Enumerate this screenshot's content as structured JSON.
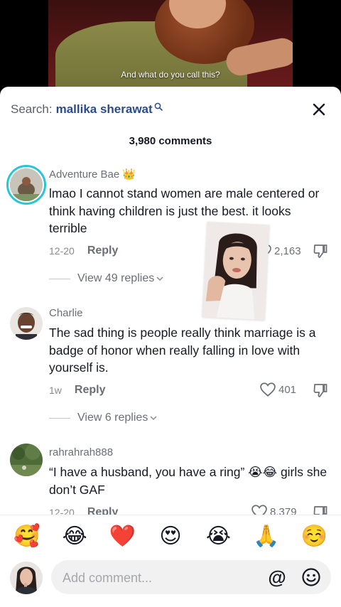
{
  "video": {
    "subtitle": "And what do you call this?"
  },
  "sheet": {
    "search_prefix": "Search:",
    "search_term": "mallika sherawat",
    "comment_count": "3,980 comments"
  },
  "comments": [
    {
      "user": "Adventure Bae 👑",
      "text": "lmao I cannot stand women are male centered or think having children is just the best. it looks terrible",
      "date": "12-20",
      "reply": "Reply",
      "likes": "2,163",
      "view_replies": "View 49 replies"
    },
    {
      "user": "Charlie",
      "text": "The sad thing is people really think marriage is a badge of honor when really falling in love with yourself is.",
      "date": "1w",
      "reply": "Reply",
      "likes": "401",
      "view_replies": "View 6 replies"
    },
    {
      "user": "rahrahrah888",
      "text": "“I have a husband, you have a ring” 😭😂 girls she don’t GAF",
      "date": "12-20",
      "reply": "Reply",
      "likes": "8,379"
    }
  ],
  "emoji_bar": [
    "🥰",
    "😂",
    "❤️",
    "😍",
    "😭",
    "🙏",
    "☺️"
  ],
  "input": {
    "placeholder": "Add comment...",
    "at_symbol": "@"
  },
  "colors": {
    "ring": "#28c5d8",
    "search_term": "#2a4b8d"
  }
}
